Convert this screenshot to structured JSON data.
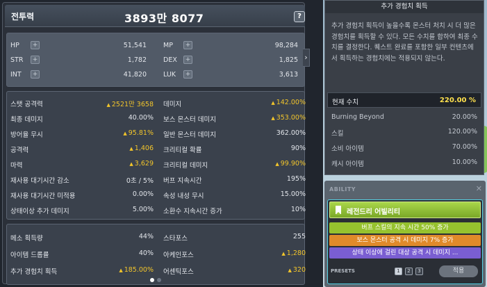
{
  "header": {
    "title": "전투력",
    "value": "3893만 8077",
    "help_label": "?"
  },
  "basic_stats": [
    {
      "left_label": "HP",
      "left_value": "51,541",
      "right_label": "MP",
      "right_value": "98,284"
    },
    {
      "left_label": "STR",
      "left_value": "1,782",
      "right_label": "DEX",
      "right_value": "1,825"
    },
    {
      "left_label": "INT",
      "left_value": "41,820",
      "right_label": "LUK",
      "right_value": "3,613"
    }
  ],
  "plus_glyph": "+",
  "expand_arrow": "›",
  "detail_stats": [
    {
      "left_label": "스탯 공격력",
      "left_value": "2521만 3658",
      "left_up": true,
      "right_label": "데미지",
      "right_value": "142.00%",
      "right_up": true
    },
    {
      "left_label": "최종 데미지",
      "left_value": "40.00%",
      "left_up": false,
      "right_label": "보스 몬스터 데미지",
      "right_value": "353.00%",
      "right_up": true
    },
    {
      "left_label": "방어율 무시",
      "left_value": "95.81%",
      "left_up": true,
      "right_label": "일반 몬스터 데미지",
      "right_value": "362.00%",
      "right_up": false
    },
    {
      "left_label": "공격력",
      "left_value": "1,406",
      "left_up": true,
      "right_label": "크리티컬 확률",
      "right_value": "90%",
      "right_up": false
    },
    {
      "left_label": "마력",
      "left_value": "3,629",
      "left_up": true,
      "right_label": "크리티컬 데미지",
      "right_value": "99.90%",
      "right_up": true
    },
    {
      "left_label": "재사용 대기시간 감소",
      "left_value": "0초 / 5%",
      "left_up": false,
      "right_label": "버프 지속시간",
      "right_value": "195%",
      "right_up": false
    },
    {
      "left_label": "재사용 대기시간 미적용",
      "left_value": "0.00%",
      "left_up": false,
      "right_label": "속성 내성 무시",
      "right_value": "15.00%",
      "right_up": false
    },
    {
      "left_label": "상태이상 추가 데미지",
      "left_value": "5.00%",
      "left_up": false,
      "right_label": "소환수 지속시간 증가",
      "right_value": "10%",
      "right_up": false
    }
  ],
  "misc_stats": [
    {
      "left_label": "메소 획득량",
      "left_value": "44%",
      "left_up": false,
      "right_label": "스타포스",
      "right_value": "255",
      "right_up": false
    },
    {
      "left_label": "아이템 드롭률",
      "left_value": "40%",
      "left_up": false,
      "right_label": "아케인포스",
      "right_value": "1,280",
      "right_up": true
    },
    {
      "left_label": "추가 경험치 획득",
      "left_value": "185.00%",
      "left_up": true,
      "right_label": "어센틱포스",
      "right_value": "320",
      "right_up": true
    }
  ],
  "exp_panel": {
    "title": "추가 경험치 획득",
    "description": "추가 경험치 획득이 높을수록 몬스터 처치 시 더 많은 경험치를 획득할 수 있다. 모든 수치를 합하여 최종 수치를 결정한다. 퀘스트 완료를 포함한 일부 컨텐츠에서 획득하는 경험치에는 적용되지 않는다.",
    "current_label": "현재 수치",
    "current_value": "220.00 %",
    "sources": [
      {
        "label": "Burning Beyond",
        "value": "20.00%"
      },
      {
        "label": "스킬",
        "value": "120.00%"
      },
      {
        "label": "소비 아이템",
        "value": "70.00%"
      },
      {
        "label": "캐시 아이템",
        "value": "10.00%"
      }
    ]
  },
  "ability": {
    "title": "ABILITY",
    "close": "✕",
    "grade": "레전드리 어빌리티",
    "lines": [
      "버프 스킬의 지속 시간 50% 증가",
      "보스 몬스터 공격 시 데미지 7% 증가",
      "상태 이상에 걸린 대상 공격 시 데미지 ..."
    ],
    "presets_label": "PRESETS",
    "presets": [
      "1",
      "2",
      "3"
    ],
    "apply_label": "적용"
  },
  "colors": {
    "gold": "#f2c52b",
    "cyan_border": "#55d3e6",
    "legendary": "#97c23a",
    "epic": "#7a5ed2",
    "unique": "#e08a2a"
  }
}
